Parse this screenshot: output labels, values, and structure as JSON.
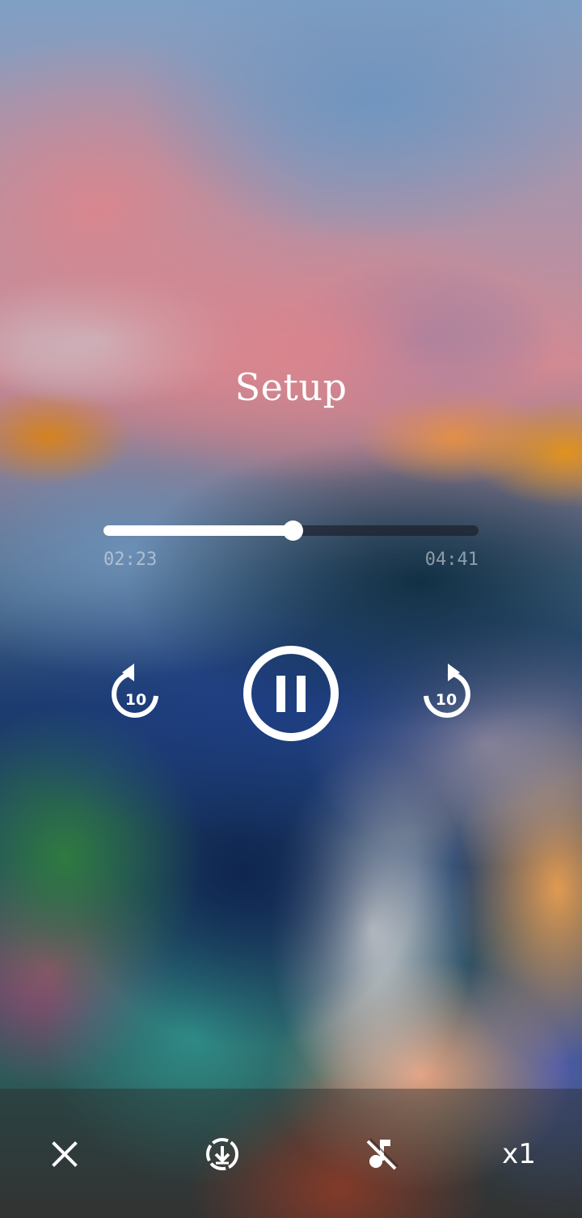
{
  "player": {
    "title": "Setup",
    "elapsed": "02:23",
    "total": "04:41",
    "progress_fraction": 0.504
  },
  "controls": {
    "rewind_label": "10",
    "forward_label": "10",
    "state": "playing"
  },
  "bottom_bar": {
    "speed_label": "x1",
    "icons": [
      "close-icon",
      "download-icon",
      "music-off-icon"
    ]
  }
}
